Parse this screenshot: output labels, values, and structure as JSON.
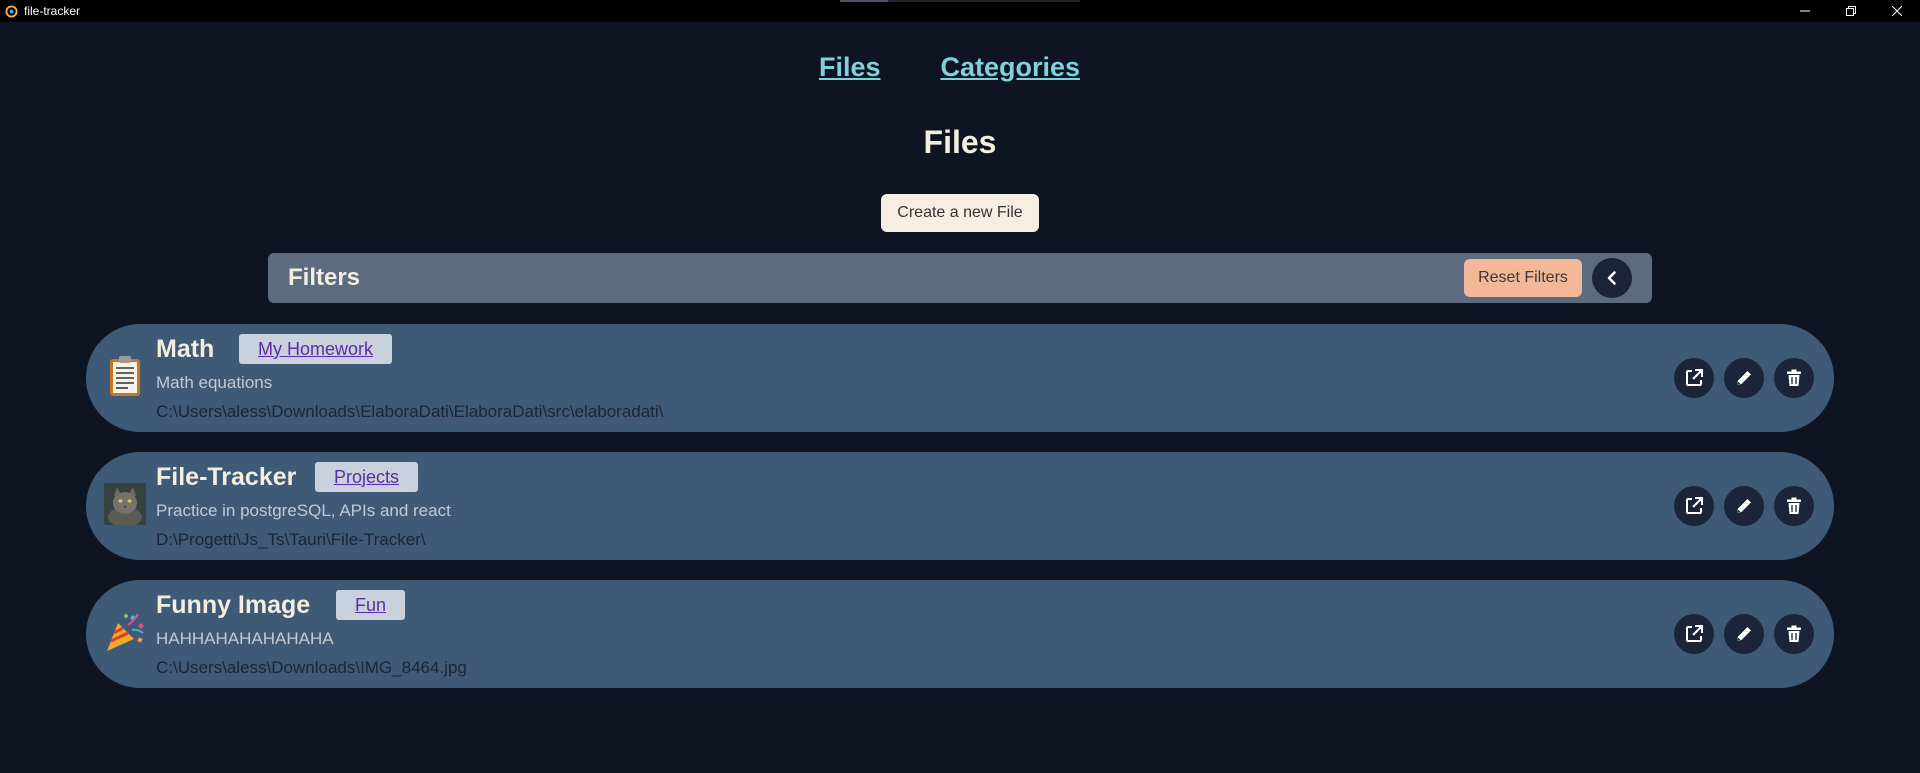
{
  "window": {
    "title": "file-tracker"
  },
  "nav": {
    "files": "Files",
    "categories": "Categories"
  },
  "page": {
    "title": "Files",
    "create_button": "Create a new File"
  },
  "filters": {
    "title": "Filters",
    "reset_button": "Reset Filters"
  },
  "files": [
    {
      "name": "Math",
      "category": "My Homework",
      "description": "Math equations",
      "path": "C:\\Users\\aless\\Downloads\\ElaboraDati\\ElaboraDati\\src\\elaboradati\\",
      "icon": "document-icon"
    },
    {
      "name": "File-Tracker",
      "category": "Projects",
      "description": "Practice in postgreSQL, APIs and react",
      "path": "D:\\Progetti\\Js_Ts\\Tauri\\File-Tracker\\",
      "icon": "cat-photo-thumbnail"
    },
    {
      "name": "Funny Image",
      "category": "Fun",
      "description": "HAHHAHAHAHAHAHA",
      "path": "C:\\Users\\aless\\Downloads\\IMG_8464.jpg",
      "icon": "party-popper-icon"
    }
  ],
  "colors": {
    "background": "#0e1422",
    "accent_link": "#7fd1de",
    "card": "#3e5a77",
    "filters_bar": "#5d6b80",
    "reset_button": "#f2b898",
    "title_text": "#f3eede"
  }
}
